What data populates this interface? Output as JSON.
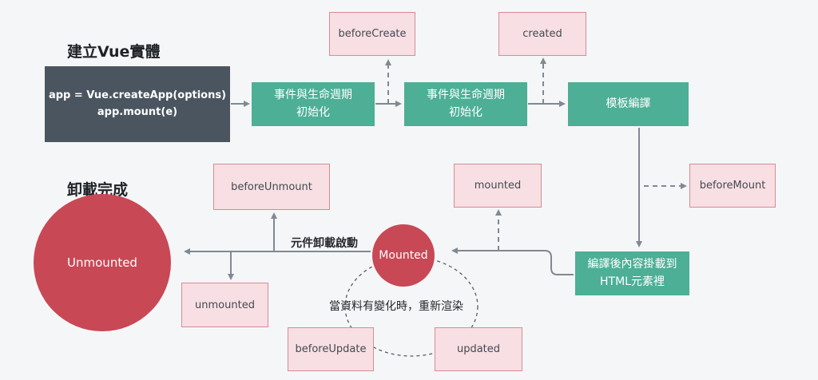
{
  "titles": {
    "create": "建立Vue實體",
    "unmount": "卸載完成"
  },
  "app_box": "app = Vue.createApp(options)\napp.mount(e)",
  "steps": {
    "init1": "事件與生命週期\n初始化",
    "init2": "事件與生命週期\n初始化",
    "compile": "模板編譯",
    "mount": "編譯後內容掛載到\nHTML元素裡"
  },
  "hooks": {
    "beforeCreate": "beforeCreate",
    "created": "created",
    "beforeMount": "beforeMount",
    "mounted": "mounted",
    "beforeUnmount": "beforeUnmount",
    "unmounted": "unmounted",
    "beforeUpdate": "beforeUpdate",
    "updated": "updated"
  },
  "states": {
    "mounted": "Mounted",
    "unmounted": "Unmounted"
  },
  "labels": {
    "unmount_trigger": "元件卸載啟動",
    "update_loop": "當資料有變化時，重新渲染"
  },
  "colors": {
    "step_green": "#4caf96",
    "hook_fill": "#f7dfe3",
    "hook_border": "#d88b95",
    "state_red": "#c84855",
    "app_dark": "#4a5560",
    "arrow_gray": "#7f8993"
  }
}
